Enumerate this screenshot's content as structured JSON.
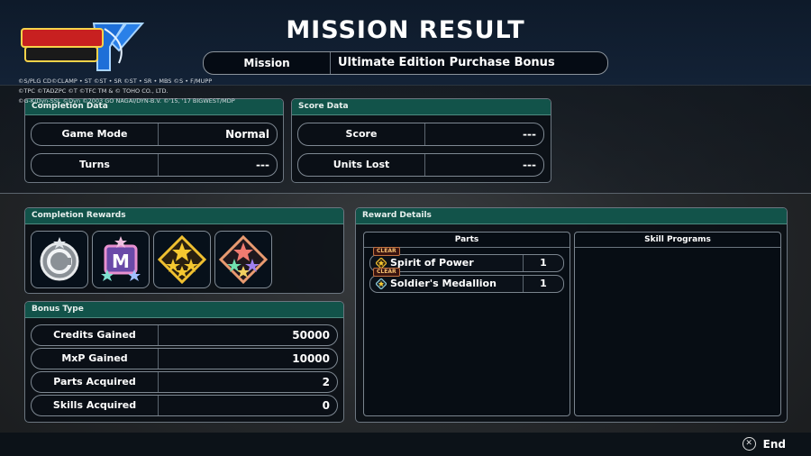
{
  "header": {
    "title": "MISSION RESULT",
    "mission_label": "Mission",
    "mission_value": "Ultimate Edition Purchase Bonus",
    "copyright": [
      "©S/PLG CD©CLAMP • ST ©ST • SR ©ST • SR • MBS ©S • F/MUPP",
      "©TPC ©TADZPC ©T ©TFC TM & © TOHO CO., LTD.",
      "©G-K/Dyn-SSL ©Dyn ©2003 GO NAGAI/DYN-B.V. ©'15, '17 BIGWEST/MDP"
    ]
  },
  "completion_data": {
    "title": "Completion Data",
    "rows": [
      {
        "label": "Game Mode",
        "value": "Normal"
      },
      {
        "label": "Turns",
        "value": "---"
      }
    ]
  },
  "score_data": {
    "title": "Score Data",
    "rows": [
      {
        "label": "Score",
        "value": "---"
      },
      {
        "label": "Units Lost",
        "value": "---"
      }
    ]
  },
  "completion_rewards": {
    "title": "Completion Rewards",
    "medals": [
      "credit-medal-icon",
      "mxp-medal-icon",
      "gold-star-medal-icon",
      "rainbow-star-medal-icon"
    ]
  },
  "bonus_type": {
    "title": "Bonus Type",
    "rows": [
      {
        "label": "Credits Gained",
        "value": "50000"
      },
      {
        "label": "MxP Gained",
        "value": "10000"
      },
      {
        "label": "Parts Acquired",
        "value": "2"
      },
      {
        "label": "Skills Acquired",
        "value": "0"
      }
    ]
  },
  "reward_details": {
    "title": "Reward Details",
    "parts_header": "Parts",
    "skills_header": "Skill Programs",
    "parts": [
      {
        "badge": "CLEAR",
        "name": "Spirit of Power",
        "qty": "1"
      },
      {
        "badge": "CLEAR",
        "name": "Soldier's Medallion",
        "qty": "1"
      }
    ]
  },
  "footer": {
    "end_label": "End",
    "button_glyph": "✕"
  },
  "colors": {
    "panel_header": "#12534a",
    "accent_gold": "#f0c030"
  }
}
